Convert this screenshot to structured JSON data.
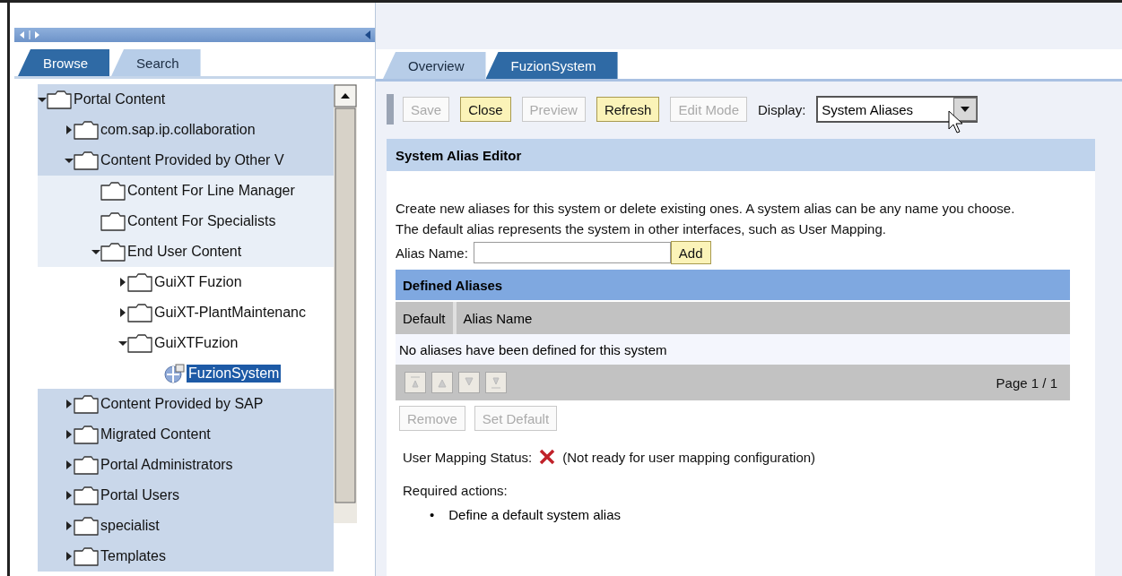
{
  "left_panel": {
    "tabs": [
      {
        "label": "Browse",
        "selected": true
      },
      {
        "label": "Search",
        "selected": false
      }
    ],
    "tree": [
      {
        "label": "Portal Content",
        "kind": "branch",
        "expanded": true,
        "selected": false,
        "children": [
          {
            "label": "com.sap.ip.collaboration",
            "kind": "branch",
            "expanded": false,
            "selected": false
          },
          {
            "label": "Content Provided by Other V",
            "kind": "branch",
            "expanded": true,
            "selected": false,
            "children": [
              {
                "label": "Content For Line Manager",
                "kind": "leaf",
                "selected": false
              },
              {
                "label": "Content For Specialists",
                "kind": "leaf",
                "selected": false
              },
              {
                "label": "End User Content",
                "kind": "branch",
                "expanded": true,
                "selected": false,
                "children": [
                  {
                    "label": "GuiXT Fuzion",
                    "kind": "branch",
                    "expanded": false,
                    "selected": false
                  },
                  {
                    "label": "GuiXT-PlantMaintenanc",
                    "kind": "branch",
                    "expanded": false,
                    "selected": false
                  },
                  {
                    "label": "GuiXTFuzion",
                    "kind": "branch",
                    "expanded": true,
                    "selected": false,
                    "children": [
                      {
                        "label": "FuzionSystem",
                        "kind": "system",
                        "selected": true
                      }
                    ]
                  }
                ]
              }
            ]
          },
          {
            "label": "Content Provided by SAP",
            "kind": "branch",
            "expanded": false,
            "selected": false
          },
          {
            "label": "Migrated Content",
            "kind": "branch",
            "expanded": false,
            "selected": false
          },
          {
            "label": "Portal Administrators",
            "kind": "branch",
            "expanded": false,
            "selected": false
          },
          {
            "label": "Portal Users",
            "kind": "branch",
            "expanded": false,
            "selected": false
          },
          {
            "label": "specialist",
            "kind": "branch",
            "expanded": false,
            "selected": false
          },
          {
            "label": "Templates",
            "kind": "branch",
            "expanded": false,
            "selected": false
          }
        ]
      }
    ]
  },
  "editor": {
    "tabs": [
      {
        "label": "Overview",
        "selected": false
      },
      {
        "label": "FuzionSystem",
        "selected": true
      }
    ],
    "toolbar": [
      {
        "label": "Save",
        "disabled": true
      },
      {
        "label": "Close",
        "disabled": false
      },
      {
        "label": "Preview",
        "disabled": true
      },
      {
        "label": "Refresh",
        "disabled": false
      },
      {
        "label": "Edit Mode",
        "disabled": true
      }
    ],
    "display": {
      "label": "Display:",
      "value": "System Aliases"
    },
    "section_title": "System Alias Editor",
    "description": "Create new aliases for this system or delete existing ones. A system alias can be any name you choose. The default alias represents the system in other interfaces, such as User Mapping.",
    "alias_field": {
      "label": "Alias Name:",
      "button": "Add"
    },
    "table": {
      "title": "Defined Aliases",
      "columns": [
        "Default",
        "Alias Name"
      ],
      "empty_message": "No aliases have been defined for this system",
      "pager": "Page 1 / 1"
    },
    "table_buttons": [
      {
        "label": "Remove",
        "disabled": true
      },
      {
        "label": "Set Default",
        "disabled": true
      }
    ],
    "status": {
      "label": "User Mapping Status:",
      "ready": false,
      "message": "(Not ready for user mapping configuration)"
    },
    "required_actions": {
      "label": "Required actions:",
      "items": [
        {
          "marker": "•",
          "text": "Define a default system alias"
        }
      ]
    }
  }
}
